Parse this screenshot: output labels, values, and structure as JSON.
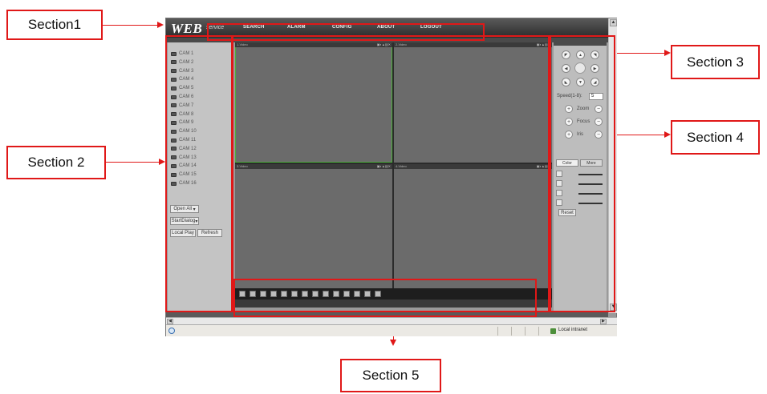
{
  "callouts": {
    "section1": "Section1",
    "section2": "Section 2",
    "section3": "Section 3",
    "section4": "Section 4",
    "section5": "Section 5"
  },
  "header": {
    "logo": "WEB",
    "logo_sub": "service",
    "nav": [
      "SEARCH",
      "ALARM",
      "CONFIG",
      "ABOUT",
      "LOGOUT"
    ]
  },
  "cameras": [
    "CAM 1",
    "CAM 2",
    "CAM 3",
    "CAM 4",
    "CAM 5",
    "CAM 6",
    "CAM 7",
    "CAM 8",
    "CAM 9",
    "CAM 10",
    "CAM 11",
    "CAM 12",
    "CAM 13",
    "CAM 14",
    "CAM 15",
    "CAM 16"
  ],
  "left_controls": {
    "open_all": "Open All",
    "start_dialog": "StartDialog",
    "local_play": "Local Play",
    "refresh": "Refresh"
  },
  "panes": [
    {
      "title": "1-Video"
    },
    {
      "title": "2-Video"
    },
    {
      "title": "3-Video"
    },
    {
      "title": "4-Video"
    }
  ],
  "ptz": {
    "speed_label": "Speed(1-8):",
    "speed_value": "5",
    "zoom": "Zoom",
    "focus": "Focus",
    "iris": "Iris",
    "plus": "+",
    "minus": "−"
  },
  "color_tabs": [
    "Color",
    "More"
  ],
  "reset": "Reset",
  "status": {
    "zone": "Local intranet"
  },
  "colors": {
    "callout": "#e01818",
    "selected_pane": "#4caf3a"
  }
}
